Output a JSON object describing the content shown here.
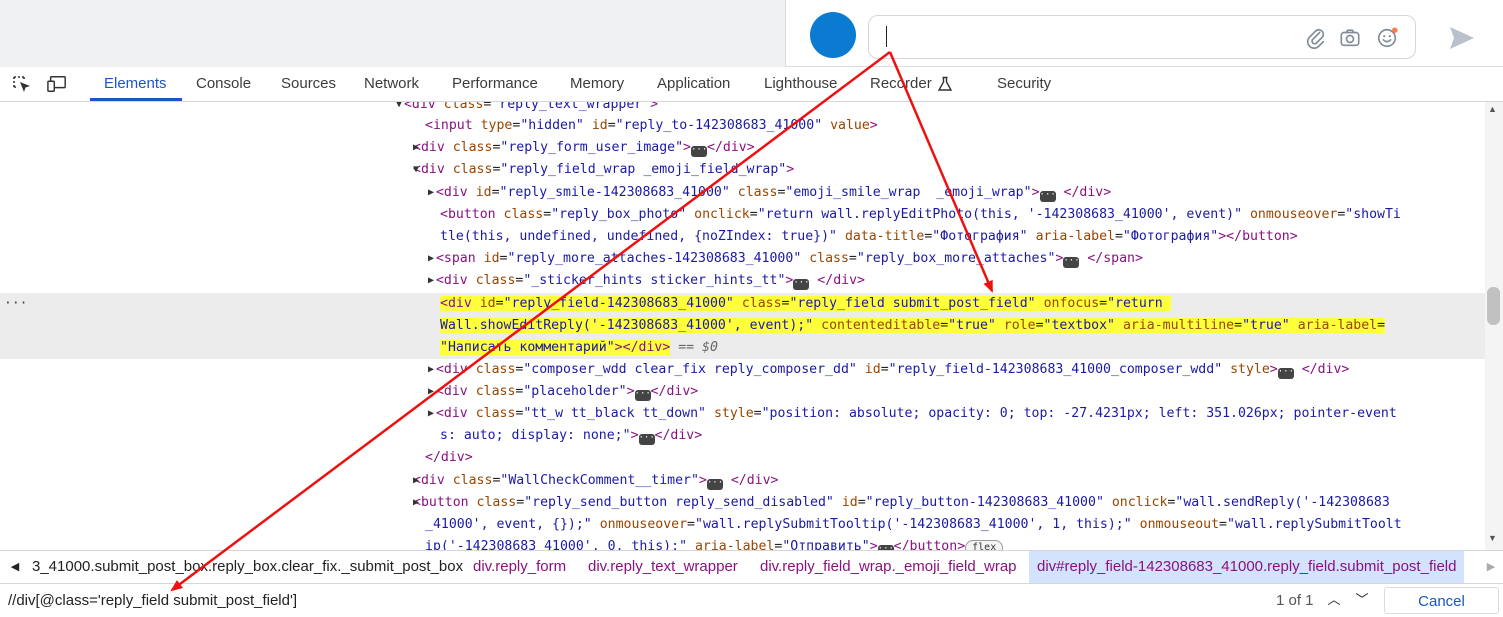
{
  "composer": {
    "icons": [
      "paperclip-icon",
      "camera-icon",
      "smile-icon",
      "send-icon"
    ],
    "avatar_color": "#0a7bd0"
  },
  "devtools": {
    "tabs": [
      "Elements",
      "Console",
      "Sources",
      "Network",
      "Performance",
      "Memory",
      "Application",
      "Lighthouse",
      "Recorder",
      "Security"
    ],
    "active_tab": "Elements",
    "tree": {
      "l0": [
        "div",
        "class",
        "reply_text_wrapper"
      ],
      "l1": [
        "input",
        "type",
        "hidden",
        "id",
        "reply_to-142308683_41000",
        "value"
      ],
      "l2": [
        "div",
        "class",
        "reply_form_user_image",
        "/div"
      ],
      "l3": [
        "div",
        "class",
        "reply_field_wrap _emoji_field_wrap"
      ],
      "l4": [
        "div",
        "id",
        "reply_smile-142308683_41000",
        "class",
        "emoji_smile_wrap  _emoji_wrap",
        "/div"
      ],
      "l5": [
        "button",
        "class",
        "reply_box_photo",
        "onclick",
        "return wall.replyEditPhoto(this, '-142308683_41000', event)",
        "onmouseover",
        "showTi"
      ],
      "l6": [
        "tle(this, undefined, undefined, {noZIndex: true})\"",
        "data-title",
        "Фотография",
        "aria-label",
        "Фотография",
        "/button"
      ],
      "l7": [
        "span",
        "id",
        "reply_more_attaches-142308683_41000",
        "class",
        "reply_box_more_attaches",
        "/span"
      ],
      "l8": [
        "div",
        "class",
        "_sticker_hints sticker_hints_tt",
        "/div"
      ],
      "l9": [
        "div",
        "id",
        "reply_field-142308683_41000",
        "class",
        "reply_field submit_post_field",
        "onfocus",
        "\"return"
      ],
      "l10": [
        "Wall.showEditReply('-142308683_41000', event);\"",
        "contenteditable",
        "true",
        "role",
        "textbox",
        "aria-multiline",
        "true",
        "aria-label"
      ],
      "l11": [
        "\"Написать комментарий\"",
        "/div",
        "== $0"
      ],
      "l12": [
        "div",
        "class",
        "composer_wdd clear_fix reply_composer_dd",
        "id",
        "reply_field-142308683_41000_composer_wdd",
        "style",
        "/div"
      ],
      "l13": [
        "div",
        "class",
        "placeholder",
        "/div"
      ],
      "l14": [
        "div",
        "class",
        "tt_w tt_black tt_down",
        "style",
        "position: absolute; opacity: 0; top: -27.4231px; left: 351.026px; pointer-event"
      ],
      "l15": [
        "s: auto; display: none;\"",
        "/div"
      ],
      "l16": [
        "/div"
      ],
      "l17": [
        "div",
        "class",
        "WallCheckComment__timer",
        "/div"
      ],
      "l18": [
        "button",
        "class",
        "reply_send_button reply_send_disabled",
        "id",
        "reply_button-142308683_41000",
        "onclick",
        "wall.sendReply('-142308683"
      ],
      "l19": [
        "_41000', event, {});\"",
        "onmouseover",
        "wall.replySubmitTooltip('-142308683_41000', 1, this);",
        "onmouseout",
        "wall.replySubmitToolt"
      ],
      "l20": [
        "ip('-142308683_41000', 0, this);\"",
        "aria-label",
        "Отправить",
        "/button",
        "flex"
      ]
    },
    "breadcrumbs": [
      "3_41000.submit_post_box.reply_box.clear_fix._submit_post_box",
      "div.reply_form",
      "div.reply_text_wrapper",
      "div.reply_field_wrap._emoji_field_wrap",
      "div#reply_field-142308683_41000.reply_field.submit_post_field"
    ],
    "search": {
      "value": "//div[@class='reply_field submit_post_field']",
      "count": "1 of 1",
      "cancel_label": "Cancel"
    }
  },
  "colors": {
    "accent": "#1a56c4",
    "highlight": "#ffff3a",
    "tag": "#881280",
    "attr": "#994500",
    "value": "#1a1aa6",
    "arrow": "#ee1111"
  }
}
